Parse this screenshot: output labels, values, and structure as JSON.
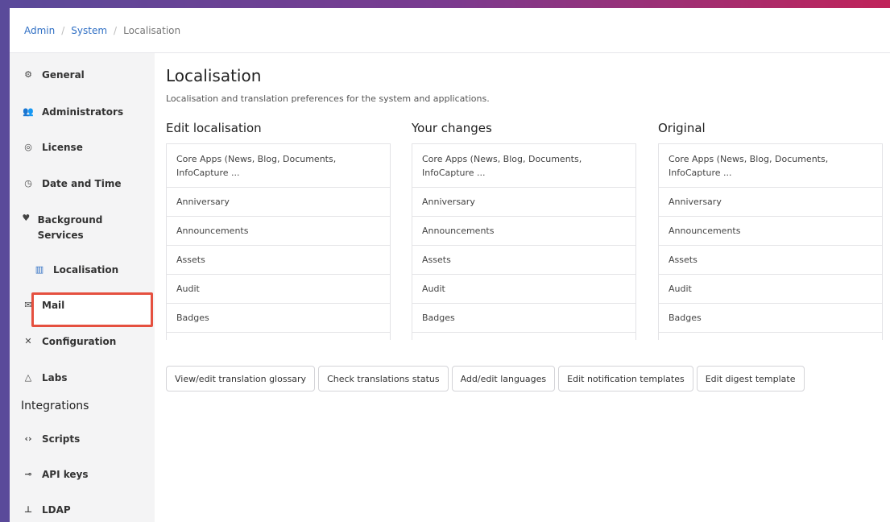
{
  "breadcrumb": {
    "admin": "Admin",
    "system": "System",
    "current": "Localisation",
    "separator": "/"
  },
  "sidebar": {
    "items": [
      {
        "label": "General",
        "icon": "gears-icon"
      },
      {
        "label": "Administrators",
        "icon": "users-icon"
      },
      {
        "label": "License",
        "icon": "badge-icon"
      },
      {
        "label": "Date and Time",
        "icon": "clock-icon"
      },
      {
        "label": "Background Services",
        "icon": "heart-pulse-icon"
      },
      {
        "label": "Localisation",
        "icon": "map-icon"
      },
      {
        "label": "Mail",
        "icon": "mail-icon"
      },
      {
        "label": "Configuration",
        "icon": "tools-icon"
      },
      {
        "label": "Labs",
        "icon": "flask-icon"
      }
    ],
    "section_heading": "Integrations",
    "integration_items": [
      {
        "label": "Scripts",
        "icon": "code-icon"
      },
      {
        "label": "API keys",
        "icon": "key-icon"
      },
      {
        "label": "LDAP",
        "icon": "sitemap-icon"
      }
    ]
  },
  "main": {
    "title": "Localisation",
    "description": "Localisation and translation preferences for the system and applications.",
    "columns": [
      {
        "title": "Edit localisation"
      },
      {
        "title": "Your changes"
      },
      {
        "title": "Original"
      }
    ],
    "rows": [
      "Core Apps (News, Blog, Documents, InfoCapture ...",
      "Anniversary",
      "Announcements",
      "Assets",
      "Audit",
      "Badges"
    ],
    "buttons": [
      "View/edit translation glossary",
      "Check translations status",
      "Add/edit languages",
      "Edit notification templates",
      "Edit digest template"
    ]
  },
  "colors": {
    "accent_link": "#2f6fc4",
    "active_highlight": "#e5503f"
  }
}
